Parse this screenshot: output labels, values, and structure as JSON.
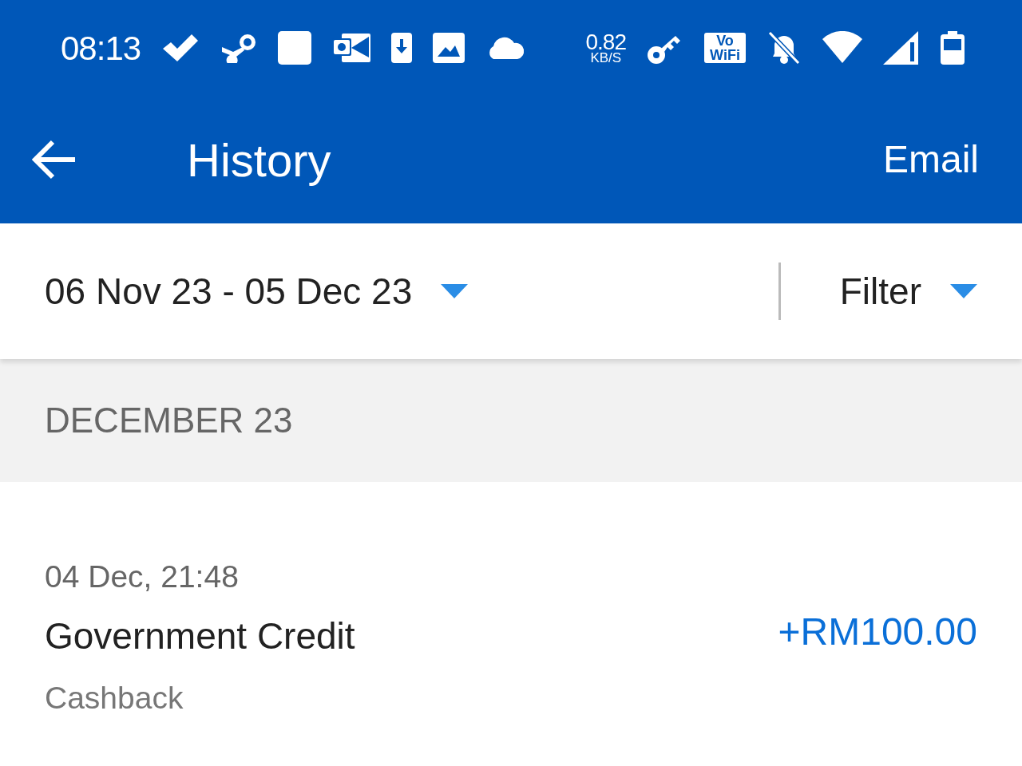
{
  "status_bar": {
    "time": "08:13",
    "net_speed": "0.82",
    "net_unit": "KB/S",
    "vowifi": [
      "Vo",
      "WiFi"
    ]
  },
  "app_bar": {
    "title": "History",
    "action": "Email"
  },
  "filters": {
    "date_range": "06 Nov 23 - 05 Dec 23",
    "filter": "Filter"
  },
  "sections": [
    {
      "heading": "DECEMBER 23",
      "transactions": [
        {
          "datetime": "04 Dec, 21:48",
          "title": "Government Credit",
          "type": "Cashback",
          "amount": "+RM100.00"
        }
      ]
    }
  ]
}
